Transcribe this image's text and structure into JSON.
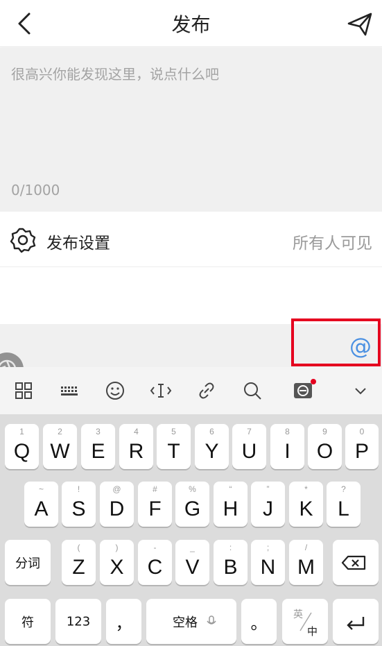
{
  "header": {
    "title": "发布"
  },
  "editor": {
    "placeholder": "很高兴你能发现这里，说点什么吧",
    "counter": "0/1000"
  },
  "settings": {
    "label": "发布设置",
    "visibility": "所有人可见"
  },
  "at_bar": {
    "at_symbol": "@"
  },
  "colors": {
    "accent": "#4a90e2",
    "highlight": "#e5001f"
  },
  "keyboard_toolbar": {
    "icons": [
      "apps-grid-icon",
      "keyboard-icon",
      "emoji-icon",
      "cursor-icon",
      "link-icon",
      "search-icon",
      "translate-icon",
      "collapse-icon"
    ]
  },
  "keyboard": {
    "row1": [
      {
        "main": "Q",
        "sub": "1"
      },
      {
        "main": "W",
        "sub": "2"
      },
      {
        "main": "E",
        "sub": "3"
      },
      {
        "main": "R",
        "sub": "4"
      },
      {
        "main": "T",
        "sub": "5"
      },
      {
        "main": "Y",
        "sub": "6"
      },
      {
        "main": "U",
        "sub": "7"
      },
      {
        "main": "I",
        "sub": "8"
      },
      {
        "main": "O",
        "sub": "9"
      },
      {
        "main": "P",
        "sub": "0"
      }
    ],
    "row2": [
      {
        "main": "A",
        "sub": "~"
      },
      {
        "main": "S",
        "sub": "!"
      },
      {
        "main": "D",
        "sub": "@"
      },
      {
        "main": "F",
        "sub": "#"
      },
      {
        "main": "G",
        "sub": "%"
      },
      {
        "main": "H",
        "sub": "“"
      },
      {
        "main": "J",
        "sub": "”"
      },
      {
        "main": "K",
        "sub": "*"
      },
      {
        "main": "L",
        "sub": "?"
      }
    ],
    "row3": [
      {
        "main": "Z",
        "sub": "("
      },
      {
        "main": "X",
        "sub": ")"
      },
      {
        "main": "C",
        "sub": "-"
      },
      {
        "main": "V",
        "sub": "_"
      },
      {
        "main": "B",
        "sub": ":"
      },
      {
        "main": "N",
        "sub": ";"
      },
      {
        "main": "M",
        "sub": "/"
      }
    ],
    "fenci": "分词",
    "fu": "符",
    "num": "123",
    "comma": "，",
    "space": "空格",
    "period": "。",
    "lang_top": "英",
    "lang_bottom": "中"
  }
}
